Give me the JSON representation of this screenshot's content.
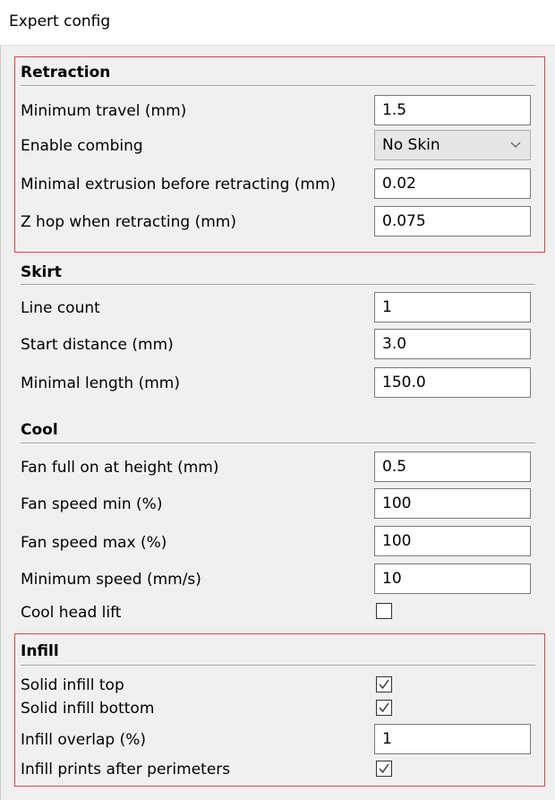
{
  "window": {
    "title": "Expert config"
  },
  "retraction": {
    "title": "Retraction",
    "min_travel": {
      "label": "Minimum travel (mm)",
      "value": "1.5"
    },
    "combing": {
      "label": "Enable combing",
      "value": "No Skin"
    },
    "min_extrusion": {
      "label": "Minimal extrusion before retracting (mm)",
      "value": "0.02"
    },
    "z_hop": {
      "label": "Z hop when retracting (mm)",
      "value": "0.075"
    }
  },
  "skirt": {
    "title": "Skirt",
    "line_count": {
      "label": "Line count",
      "value": "1"
    },
    "start_distance": {
      "label": "Start distance (mm)",
      "value": "3.0"
    },
    "min_length": {
      "label": "Minimal length (mm)",
      "value": "150.0"
    }
  },
  "cool": {
    "title": "Cool",
    "fan_full_height": {
      "label": "Fan full on at height (mm)",
      "value": "0.5"
    },
    "fan_min": {
      "label": "Fan speed min (%)",
      "value": "100"
    },
    "fan_max": {
      "label": "Fan speed max (%)",
      "value": "100"
    },
    "min_speed": {
      "label": "Minimum speed (mm/s)",
      "value": "10"
    },
    "head_lift": {
      "label": "Cool head lift",
      "checked": false
    }
  },
  "infill": {
    "title": "Infill",
    "solid_top": {
      "label": "Solid infill top",
      "checked": true
    },
    "solid_bottom": {
      "label": "Solid infill bottom",
      "checked": true
    },
    "overlap": {
      "label": "Infill overlap (%)",
      "value": "1"
    },
    "after_perimeters": {
      "label": "Infill prints after perimeters",
      "checked": true
    }
  },
  "colors": {
    "highlight": "#e0404c",
    "background": "#f0f0f0"
  }
}
